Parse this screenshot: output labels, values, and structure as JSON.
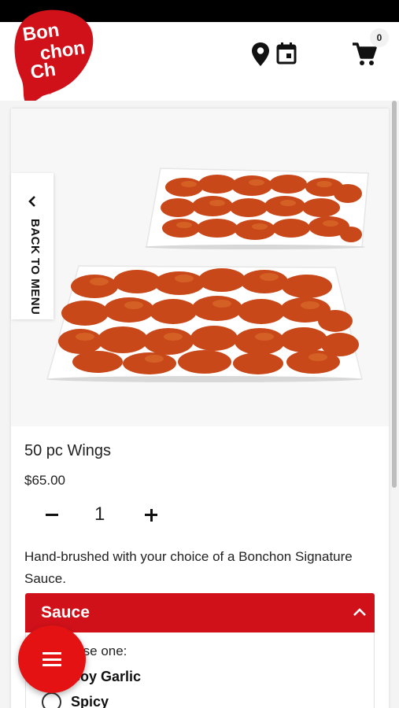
{
  "brand": {
    "logo_line1": "Bon",
    "logo_line2": "Ch",
    "accent": "#d0111a"
  },
  "header": {
    "cart_count": "0",
    "icons": [
      "location-pin-icon",
      "calendar-icon",
      "cart-icon"
    ]
  },
  "back_to_menu": "BACK TO MENU",
  "product": {
    "title": "50 pc Wings",
    "price": "$65.00",
    "quantity": "1",
    "description": "Hand-brushed with your choice of a Bonchon Signature Sauce."
  },
  "sauce": {
    "title": "Sauce",
    "choose_text": "Choose one:",
    "options": [
      {
        "label": "Soy Garlic"
      },
      {
        "label": "Spicy"
      }
    ]
  }
}
